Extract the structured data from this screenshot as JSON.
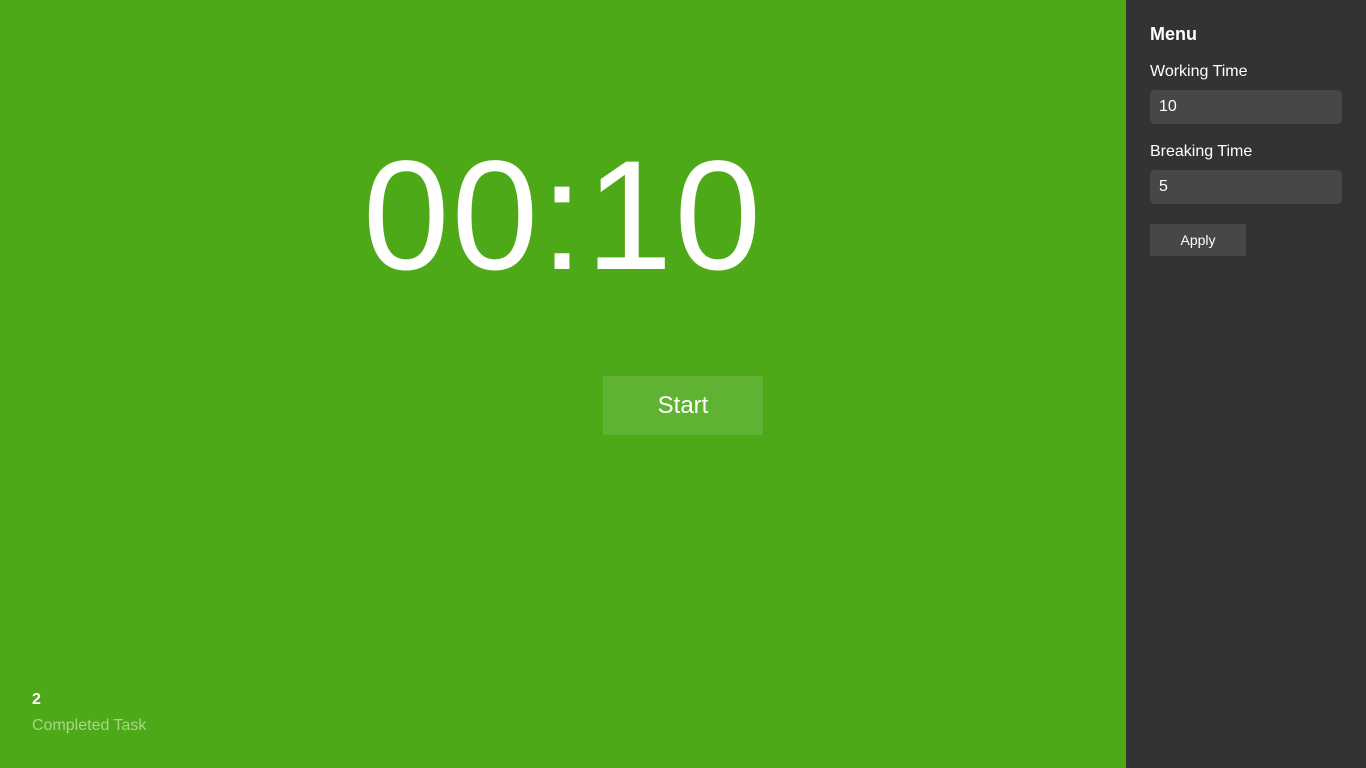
{
  "timer": {
    "display": "00:10",
    "start_label": "Start"
  },
  "stats": {
    "completed_count": "2",
    "completed_label": "Completed Task"
  },
  "menu": {
    "title": "Menu",
    "working_time_label": "Working Time",
    "working_time_value": "10",
    "breaking_time_label": "Breaking Time",
    "breaking_time_value": "5",
    "apply_label": "Apply"
  },
  "colors": {
    "main_background": "#4ea918",
    "sidebar_background": "#333333",
    "button_background": "#5fb232",
    "input_background": "#474747"
  }
}
